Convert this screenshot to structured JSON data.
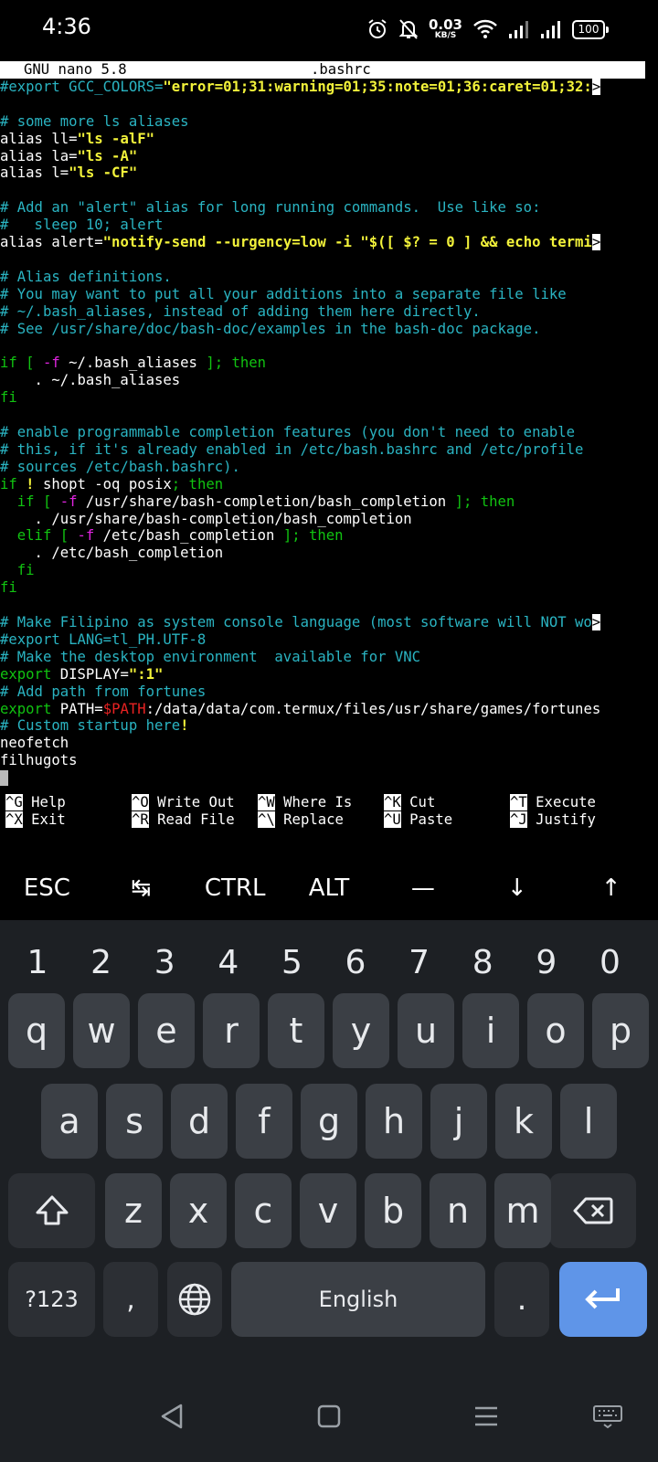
{
  "status": {
    "time": "4:36",
    "net_speed_value": "0.03",
    "net_speed_unit": "KB/S",
    "battery": "100",
    "icons": [
      "alarm-icon",
      "mute-icon",
      "wifi-icon",
      "signal-icon",
      "signal-icon",
      "battery-icon"
    ]
  },
  "nano": {
    "editor": "GNU nano 5.8",
    "file": ".bashrc",
    "lines": [
      [
        {
          "t": "#export GCC_COLORS=",
          "c": "c"
        },
        {
          "t": "\"error=01;31:warning=01;35:note=01;36:caret=01;32:",
          "c": "y"
        },
        {
          "t": ">",
          "c": "ovf"
        }
      ],
      [],
      [
        {
          "t": "# some more ls aliases",
          "c": "c"
        }
      ],
      [
        {
          "t": "alias ll=",
          "c": "w"
        },
        {
          "t": "\"ls -alF\"",
          "c": "y"
        }
      ],
      [
        {
          "t": "alias la=",
          "c": "w"
        },
        {
          "t": "\"ls -A\"",
          "c": "y"
        }
      ],
      [
        {
          "t": "alias l=",
          "c": "w"
        },
        {
          "t": "\"ls -CF\"",
          "c": "y"
        }
      ],
      [],
      [
        {
          "t": "# Add an \"alert\" alias for long running commands.  Use like so:",
          "c": "c"
        }
      ],
      [
        {
          "t": "#   sleep 10; alert",
          "c": "c"
        }
      ],
      [
        {
          "t": "alias alert=",
          "c": "w"
        },
        {
          "t": "\"notify-send --urgency=low -i \"$([ $? = 0 ] && echo termi",
          "c": "y"
        },
        {
          "t": ">",
          "c": "ovf"
        }
      ],
      [],
      [
        {
          "t": "# Alias definitions.",
          "c": "c"
        }
      ],
      [
        {
          "t": "# You may want to put all your additions into a separate file like",
          "c": "c"
        }
      ],
      [
        {
          "t": "# ~/.bash_aliases, instead of adding them here directly.",
          "c": "c"
        }
      ],
      [
        {
          "t": "# See /usr/share/doc/bash-doc/examples in the bash-doc package.",
          "c": "c"
        }
      ],
      [],
      [
        {
          "t": "if [ ",
          "c": "g"
        },
        {
          "t": "-f",
          "c": "m"
        },
        {
          "t": " ~/.bash_aliases ",
          "c": "w"
        },
        {
          "t": "]; then",
          "c": "g"
        }
      ],
      [
        {
          "t": "    . ~/.bash_aliases",
          "c": "w"
        }
      ],
      [
        {
          "t": "fi",
          "c": "g"
        }
      ],
      [],
      [
        {
          "t": "# enable programmable completion features (you don't need to enable",
          "c": "c"
        }
      ],
      [
        {
          "t": "# this, if it's already enabled in /etc/bash.bashrc and /etc/profile",
          "c": "c"
        }
      ],
      [
        {
          "t": "# sources /etc/bash.bashrc).",
          "c": "c"
        }
      ],
      [
        {
          "t": "if ",
          "c": "g"
        },
        {
          "t": "!",
          "c": "y"
        },
        {
          "t": " shopt -oq posix",
          "c": "w"
        },
        {
          "t": "; then",
          "c": "g"
        }
      ],
      [
        {
          "t": "  if [ ",
          "c": "g"
        },
        {
          "t": "-f",
          "c": "m"
        },
        {
          "t": " /usr/share/bash-completion/bash_completion ",
          "c": "w"
        },
        {
          "t": "]; then",
          "c": "g"
        }
      ],
      [
        {
          "t": "    . /usr/share/bash-completion/bash_completion",
          "c": "w"
        }
      ],
      [
        {
          "t": "  elif [ ",
          "c": "g"
        },
        {
          "t": "-f",
          "c": "m"
        },
        {
          "t": " /etc/bash_completion ",
          "c": "w"
        },
        {
          "t": "]; then",
          "c": "g"
        }
      ],
      [
        {
          "t": "    . /etc/bash_completion",
          "c": "w"
        }
      ],
      [
        {
          "t": "  fi",
          "c": "g"
        }
      ],
      [
        {
          "t": "fi",
          "c": "g"
        }
      ],
      [],
      [
        {
          "t": "# Make Filipino as system console language (most software will NOT wo",
          "c": "c"
        },
        {
          "t": ">",
          "c": "ovf"
        }
      ],
      [
        {
          "t": "#export LANG=tl_PH.UTF-8",
          "c": "c"
        }
      ],
      [
        {
          "t": "# Make the desktop environment  available for VNC",
          "c": "c"
        }
      ],
      [
        {
          "t": "export",
          "c": "g"
        },
        {
          "t": " DISPLAY=",
          "c": "w"
        },
        {
          "t": "\":1\"",
          "c": "y"
        }
      ],
      [
        {
          "t": "# Add path from fortunes",
          "c": "c"
        }
      ],
      [
        {
          "t": "export",
          "c": "g"
        },
        {
          "t": " PATH=",
          "c": "w"
        },
        {
          "t": "$PATH",
          "c": "r"
        },
        {
          "t": ":/data/data/com.termux/files/usr/share/games/fortunes",
          "c": "w"
        }
      ],
      [
        {
          "t": "# Custom startup here",
          "c": "c"
        },
        {
          "t": "!",
          "c": "y"
        }
      ],
      [
        {
          "t": "neofetch",
          "c": "w"
        }
      ],
      [
        {
          "t": "filhugots",
          "c": "w"
        }
      ],
      [
        {
          "t": "",
          "c": "cursor"
        }
      ]
    ],
    "shortcuts": [
      [
        {
          "key": "^G",
          "label": "Help"
        },
        {
          "key": "^O",
          "label": "Write Out"
        },
        {
          "key": "^W",
          "label": "Where Is"
        },
        {
          "key": "^K",
          "label": "Cut"
        },
        {
          "key": "^T",
          "label": "Execute"
        }
      ],
      [
        {
          "key": "^X",
          "label": "Exit"
        },
        {
          "key": "^R",
          "label": "Read File"
        },
        {
          "key": "^\\",
          "label": "Replace"
        },
        {
          "key": "^U",
          "label": "Paste"
        },
        {
          "key": "^J",
          "label": "Justify"
        }
      ]
    ]
  },
  "extra_keys": [
    {
      "label": "ESC",
      "name": "esc-key"
    },
    {
      "label": "↹",
      "name": "tab-key"
    },
    {
      "label": "CTRL",
      "name": "ctrl-key"
    },
    {
      "label": "ALT",
      "name": "alt-key"
    },
    {
      "label": "—",
      "name": "dash-key"
    },
    {
      "label": "↓",
      "name": "arrow-down-key"
    },
    {
      "label": "↑",
      "name": "arrow-up-key"
    }
  ],
  "keyboard": {
    "numbers": [
      "1",
      "2",
      "3",
      "4",
      "5",
      "6",
      "7",
      "8",
      "9",
      "0"
    ],
    "row1": [
      "q",
      "w",
      "e",
      "r",
      "t",
      "y",
      "u",
      "i",
      "o",
      "p"
    ],
    "row2": [
      "a",
      "s",
      "d",
      "f",
      "g",
      "h",
      "j",
      "k",
      "l"
    ],
    "row3": [
      "z",
      "x",
      "c",
      "v",
      "b",
      "n",
      "m"
    ],
    "symbols_label": "?123",
    "comma_label": ",",
    "space_label": "English",
    "period_label": "."
  }
}
